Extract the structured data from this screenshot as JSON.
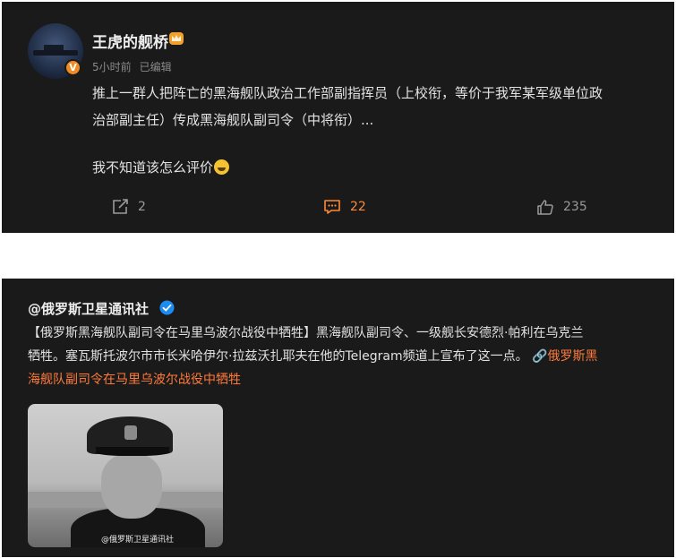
{
  "post1": {
    "username": "王虎的舰桥",
    "verified_badge": "V",
    "time": "5小时前",
    "edited": "已编辑",
    "text_line1": "推上一群人把阵亡的黑海舰队政治工作部副指挥员（上校衔，等价于我军某军级单位政",
    "text_line2": "治部副主任）传成黑海舰队副司令（中将衔）...",
    "text_line3": "我不知道该怎么评价",
    "actions": {
      "repost_count": "2",
      "comment_count": "22",
      "like_count": "235"
    },
    "colors": {
      "accent": "#ff8a35",
      "badge": "#f08a24"
    }
  },
  "post2": {
    "account": "@俄罗斯卫星通讯社",
    "line1": "【俄罗斯黑海舰队副司令在马里乌波尔战役中牺牲】黑海舰队副司令、一级舰长安德烈·帕利在乌克兰",
    "line2": "牺牲。塞瓦斯托波尔市市长米哈伊尔·拉兹沃扎耶夫在他的Telegram频道上宣布了这一点。",
    "link_line2": "俄罗斯黑",
    "link_line3": "海舰队副司令在马里乌波尔战役中牺牲",
    "image_watermark": "@俄罗斯卫星通讯社",
    "colors": {
      "link": "#ff7a3a",
      "verified": "#1d8cf0"
    }
  }
}
